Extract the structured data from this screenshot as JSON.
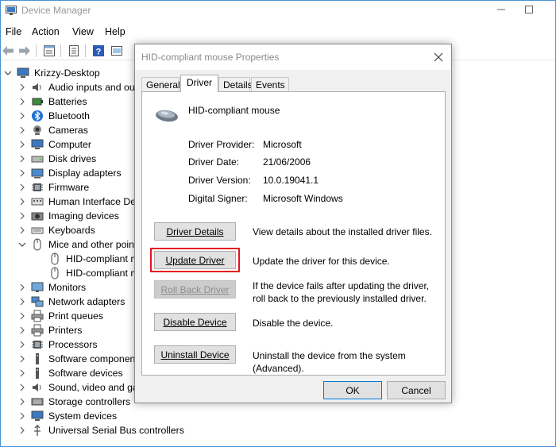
{
  "window": {
    "title": "Device Manager"
  },
  "menu": [
    "File",
    "Action",
    "View",
    "Help"
  ],
  "tree": {
    "root": "Krizzy-Desktop",
    "items": [
      {
        "label": "Audio inputs and out",
        "icon": "speaker-icon",
        "expanded": false
      },
      {
        "label": "Batteries",
        "icon": "battery-icon",
        "expanded": false
      },
      {
        "label": "Bluetooth",
        "icon": "bluetooth-icon",
        "expanded": false
      },
      {
        "label": "Cameras",
        "icon": "camera-icon",
        "expanded": false
      },
      {
        "label": "Computer",
        "icon": "computer-icon",
        "expanded": false
      },
      {
        "label": "Disk drives",
        "icon": "disk-icon",
        "expanded": false
      },
      {
        "label": "Display adapters",
        "icon": "display-icon",
        "expanded": false
      },
      {
        "label": "Firmware",
        "icon": "chip-icon",
        "expanded": false
      },
      {
        "label": "Human Interface Dev",
        "icon": "hid-icon",
        "expanded": false
      },
      {
        "label": "Imaging devices",
        "icon": "imaging-icon",
        "expanded": false
      },
      {
        "label": "Keyboards",
        "icon": "keyboard-icon",
        "expanded": false
      },
      {
        "label": "Mice and other point",
        "icon": "mouse-icon",
        "expanded": true
      },
      {
        "label": "HID-compliant m",
        "icon": "mouse-icon",
        "child": true
      },
      {
        "label": "HID-compliant m",
        "icon": "mouse-icon",
        "child": true
      },
      {
        "label": "Monitors",
        "icon": "monitor-icon",
        "expanded": false
      },
      {
        "label": "Network adapters",
        "icon": "network-icon",
        "expanded": false
      },
      {
        "label": "Print queues",
        "icon": "printer-icon",
        "expanded": false
      },
      {
        "label": "Printers",
        "icon": "printer-icon",
        "expanded": false
      },
      {
        "label": "Processors",
        "icon": "chip-icon",
        "expanded": false
      },
      {
        "label": "Software component",
        "icon": "component-icon",
        "expanded": false
      },
      {
        "label": "Software devices",
        "icon": "component-icon",
        "expanded": false
      },
      {
        "label": "Sound, video and gar",
        "icon": "speaker-icon",
        "expanded": false
      },
      {
        "label": "Storage controllers",
        "icon": "storage-icon",
        "expanded": false
      },
      {
        "label": "System devices",
        "icon": "computer-icon",
        "expanded": false
      },
      {
        "label": "Universal Serial Bus controllers",
        "icon": "usb-icon",
        "expanded": false
      }
    ]
  },
  "dialog": {
    "title": "HID-compliant mouse Properties",
    "tabs": [
      "General",
      "Driver",
      "Details",
      "Events"
    ],
    "active_tab": "Driver",
    "device_name": "HID-compliant mouse",
    "props": [
      {
        "label": "Driver Provider:",
        "value": "Microsoft"
      },
      {
        "label": "Driver Date:",
        "value": "21/06/2006"
      },
      {
        "label": "Driver Version:",
        "value": "10.0.19041.1"
      },
      {
        "label": "Digital Signer:",
        "value": "Microsoft Windows"
      }
    ],
    "buttons": [
      {
        "label": "Driver Details",
        "desc": "View details about the installed driver files.",
        "enabled": true
      },
      {
        "label": "Update Driver",
        "desc": "Update the driver for this device.",
        "enabled": true,
        "highlighted": true
      },
      {
        "label": "Roll Back Driver",
        "desc": "If the device fails after updating the driver, roll back to the previously installed driver.",
        "enabled": false
      },
      {
        "label": "Disable Device",
        "desc": "Disable the device.",
        "enabled": true
      },
      {
        "label": "Uninstall Device",
        "desc": "Uninstall the device from the system (Advanced).",
        "enabled": true
      }
    ],
    "ok_label": "OK",
    "cancel_label": "Cancel",
    "highlight_color": "#e8101e"
  }
}
